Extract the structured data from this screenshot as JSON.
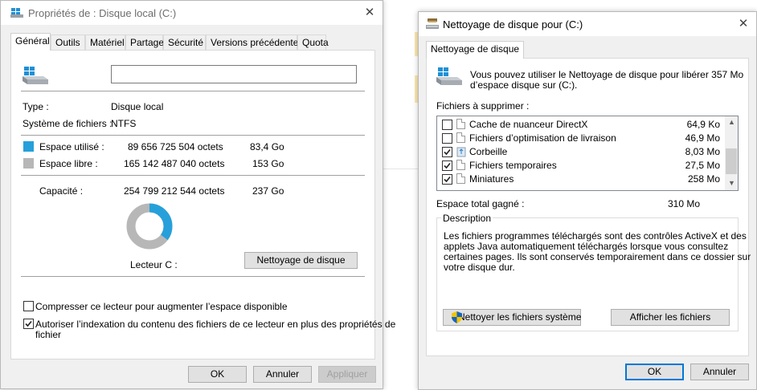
{
  "left_window": {
    "title": "Propriétés de : Disque local (C:)",
    "tabs": [
      "Général",
      "Outils",
      "Matériel",
      "Partage",
      "Sécurité",
      "Versions précédentes",
      "Quota"
    ],
    "name_field_value": "",
    "type_label": "Type :",
    "type_value": "Disque local",
    "fs_label": "Système de fichiers :",
    "fs_value": "NTFS",
    "used_label": "Espace utilisé :",
    "used_bytes": "89 656 725 504 octets",
    "used_gb": "83,4 Go",
    "free_label": "Espace libre :",
    "free_bytes": "165 142 487 040 octets",
    "free_gb": "153 Go",
    "capacity_label": "Capacité :",
    "capacity_bytes": "254 799 212 544 octets",
    "capacity_gb": "237 Go",
    "drive_label": "Lecteur C :",
    "used_fraction": 0.352,
    "cleanup_button": "Nettoyage de disque",
    "compress_label": "Compresser ce lecteur pour augmenter l’espace disponible",
    "compress_checked": false,
    "index_label_line1": "Autoriser l’indexation du contenu des fichiers de ce lecteur en plus des propriétés de",
    "index_label_line2": "fichier",
    "index_checked": true,
    "ok": "OK",
    "cancel": "Annuler",
    "apply": "Appliquer",
    "used_color": "#26a0da",
    "free_color": "#b7b7b7"
  },
  "right_window": {
    "title": "Nettoyage de disque pour  (C:)",
    "tab": "Nettoyage de disque",
    "intro_line1": "Vous pouvez utiliser le Nettoyage de disque pour libérer 357 Mo",
    "intro_line2": "d’espace disque sur  (C:).",
    "files_label": "Fichiers à supprimer :",
    "files": [
      {
        "name": "Cache de nuanceur DirectX",
        "size": "64,9 Ko",
        "checked": false,
        "icon": "file-icon"
      },
      {
        "name": "Fichiers d’optimisation de livraison",
        "size": "46,9 Mo",
        "checked": false,
        "icon": "file-icon"
      },
      {
        "name": "Corbeille",
        "size": "8,03 Mo",
        "checked": true,
        "icon": "recycle-bin-icon"
      },
      {
        "name": "Fichiers temporaires",
        "size": "27,5 Mo",
        "checked": true,
        "icon": "file-icon"
      },
      {
        "name": "Miniatures",
        "size": "258 Mo",
        "checked": true,
        "icon": "file-icon"
      }
    ],
    "total_label": "Espace total gagné :",
    "total_value": "310 Mo",
    "description_title": "Description",
    "description_lines": [
      "Les fichiers programmes téléchargés sont des contrôles ActiveX et des",
      "applets Java automatiquement téléchargés lorsque vous consultez",
      "certaines pages. Ils sont conservés temporairement dans ce dossier sur",
      "votre disque dur."
    ],
    "cleanup_system_button": "Nettoyer les fichiers système",
    "view_files_button": "Afficher les fichiers",
    "ok": "OK",
    "cancel": "Annuler"
  }
}
